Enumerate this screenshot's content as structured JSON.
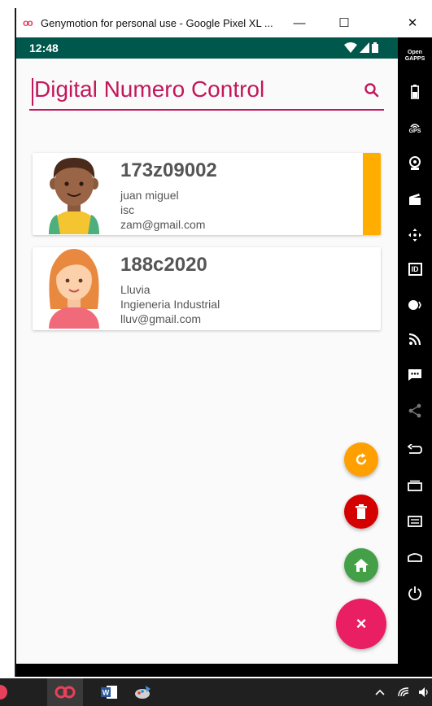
{
  "window": {
    "title": "Genymotion for personal use - Google Pixel XL ...",
    "minimize_label": "—",
    "maximize_label": "☐",
    "close_label": "✕"
  },
  "status_bar": {
    "time": "12:48"
  },
  "app": {
    "search_text": "Digital Numero Control",
    "accent_color": "#c2185b",
    "students": [
      {
        "code": "173z09002",
        "name": "juan miguel",
        "career": "isc",
        "email": "zam@gmail.com",
        "avatar": "boy-avatar-icon",
        "highlight_color": "#ffae00"
      },
      {
        "code": "188c2020",
        "name": "Lluvia",
        "career": "Ingieneria Industrial",
        "email": "lluv@gmail.com",
        "avatar": "girl-avatar-icon"
      }
    ]
  },
  "fabs": {
    "refresh_color": "#ffa000",
    "delete_color": "#d50000",
    "home_color": "#43a047",
    "main_color": "#e91e63",
    "main_label": "×"
  },
  "side_toolbar": {
    "open_gapps_label": "Open GAPPS",
    "gps_label": "GPS",
    "id_label": "ID"
  }
}
